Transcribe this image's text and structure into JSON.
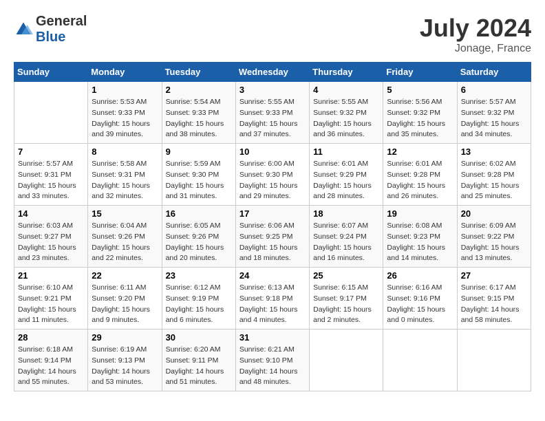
{
  "header": {
    "logo_text_general": "General",
    "logo_text_blue": "Blue",
    "month_year": "July 2024",
    "location": "Jonage, France"
  },
  "calendar": {
    "days_of_week": [
      "Sunday",
      "Monday",
      "Tuesday",
      "Wednesday",
      "Thursday",
      "Friday",
      "Saturday"
    ],
    "weeks": [
      [
        {
          "day": "",
          "sunrise": "",
          "sunset": "",
          "daylight": ""
        },
        {
          "day": "1",
          "sunrise": "Sunrise: 5:53 AM",
          "sunset": "Sunset: 9:33 PM",
          "daylight": "Daylight: 15 hours and 39 minutes."
        },
        {
          "day": "2",
          "sunrise": "Sunrise: 5:54 AM",
          "sunset": "Sunset: 9:33 PM",
          "daylight": "Daylight: 15 hours and 38 minutes."
        },
        {
          "day": "3",
          "sunrise": "Sunrise: 5:55 AM",
          "sunset": "Sunset: 9:33 PM",
          "daylight": "Daylight: 15 hours and 37 minutes."
        },
        {
          "day": "4",
          "sunrise": "Sunrise: 5:55 AM",
          "sunset": "Sunset: 9:32 PM",
          "daylight": "Daylight: 15 hours and 36 minutes."
        },
        {
          "day": "5",
          "sunrise": "Sunrise: 5:56 AM",
          "sunset": "Sunset: 9:32 PM",
          "daylight": "Daylight: 15 hours and 35 minutes."
        },
        {
          "day": "6",
          "sunrise": "Sunrise: 5:57 AM",
          "sunset": "Sunset: 9:32 PM",
          "daylight": "Daylight: 15 hours and 34 minutes."
        }
      ],
      [
        {
          "day": "7",
          "sunrise": "Sunrise: 5:57 AM",
          "sunset": "Sunset: 9:31 PM",
          "daylight": "Daylight: 15 hours and 33 minutes."
        },
        {
          "day": "8",
          "sunrise": "Sunrise: 5:58 AM",
          "sunset": "Sunset: 9:31 PM",
          "daylight": "Daylight: 15 hours and 32 minutes."
        },
        {
          "day": "9",
          "sunrise": "Sunrise: 5:59 AM",
          "sunset": "Sunset: 9:30 PM",
          "daylight": "Daylight: 15 hours and 31 minutes."
        },
        {
          "day": "10",
          "sunrise": "Sunrise: 6:00 AM",
          "sunset": "Sunset: 9:30 PM",
          "daylight": "Daylight: 15 hours and 29 minutes."
        },
        {
          "day": "11",
          "sunrise": "Sunrise: 6:01 AM",
          "sunset": "Sunset: 9:29 PM",
          "daylight": "Daylight: 15 hours and 28 minutes."
        },
        {
          "day": "12",
          "sunrise": "Sunrise: 6:01 AM",
          "sunset": "Sunset: 9:28 PM",
          "daylight": "Daylight: 15 hours and 26 minutes."
        },
        {
          "day": "13",
          "sunrise": "Sunrise: 6:02 AM",
          "sunset": "Sunset: 9:28 PM",
          "daylight": "Daylight: 15 hours and 25 minutes."
        }
      ],
      [
        {
          "day": "14",
          "sunrise": "Sunrise: 6:03 AM",
          "sunset": "Sunset: 9:27 PM",
          "daylight": "Daylight: 15 hours and 23 minutes."
        },
        {
          "day": "15",
          "sunrise": "Sunrise: 6:04 AM",
          "sunset": "Sunset: 9:26 PM",
          "daylight": "Daylight: 15 hours and 22 minutes."
        },
        {
          "day": "16",
          "sunrise": "Sunrise: 6:05 AM",
          "sunset": "Sunset: 9:26 PM",
          "daylight": "Daylight: 15 hours and 20 minutes."
        },
        {
          "day": "17",
          "sunrise": "Sunrise: 6:06 AM",
          "sunset": "Sunset: 9:25 PM",
          "daylight": "Daylight: 15 hours and 18 minutes."
        },
        {
          "day": "18",
          "sunrise": "Sunrise: 6:07 AM",
          "sunset": "Sunset: 9:24 PM",
          "daylight": "Daylight: 15 hours and 16 minutes."
        },
        {
          "day": "19",
          "sunrise": "Sunrise: 6:08 AM",
          "sunset": "Sunset: 9:23 PM",
          "daylight": "Daylight: 15 hours and 14 minutes."
        },
        {
          "day": "20",
          "sunrise": "Sunrise: 6:09 AM",
          "sunset": "Sunset: 9:22 PM",
          "daylight": "Daylight: 15 hours and 13 minutes."
        }
      ],
      [
        {
          "day": "21",
          "sunrise": "Sunrise: 6:10 AM",
          "sunset": "Sunset: 9:21 PM",
          "daylight": "Daylight: 15 hours and 11 minutes."
        },
        {
          "day": "22",
          "sunrise": "Sunrise: 6:11 AM",
          "sunset": "Sunset: 9:20 PM",
          "daylight": "Daylight: 15 hours and 9 minutes."
        },
        {
          "day": "23",
          "sunrise": "Sunrise: 6:12 AM",
          "sunset": "Sunset: 9:19 PM",
          "daylight": "Daylight: 15 hours and 6 minutes."
        },
        {
          "day": "24",
          "sunrise": "Sunrise: 6:13 AM",
          "sunset": "Sunset: 9:18 PM",
          "daylight": "Daylight: 15 hours and 4 minutes."
        },
        {
          "day": "25",
          "sunrise": "Sunrise: 6:15 AM",
          "sunset": "Sunset: 9:17 PM",
          "daylight": "Daylight: 15 hours and 2 minutes."
        },
        {
          "day": "26",
          "sunrise": "Sunrise: 6:16 AM",
          "sunset": "Sunset: 9:16 PM",
          "daylight": "Daylight: 15 hours and 0 minutes."
        },
        {
          "day": "27",
          "sunrise": "Sunrise: 6:17 AM",
          "sunset": "Sunset: 9:15 PM",
          "daylight": "Daylight: 14 hours and 58 minutes."
        }
      ],
      [
        {
          "day": "28",
          "sunrise": "Sunrise: 6:18 AM",
          "sunset": "Sunset: 9:14 PM",
          "daylight": "Daylight: 14 hours and 55 minutes."
        },
        {
          "day": "29",
          "sunrise": "Sunrise: 6:19 AM",
          "sunset": "Sunset: 9:13 PM",
          "daylight": "Daylight: 14 hours and 53 minutes."
        },
        {
          "day": "30",
          "sunrise": "Sunrise: 6:20 AM",
          "sunset": "Sunset: 9:11 PM",
          "daylight": "Daylight: 14 hours and 51 minutes."
        },
        {
          "day": "31",
          "sunrise": "Sunrise: 6:21 AM",
          "sunset": "Sunset: 9:10 PM",
          "daylight": "Daylight: 14 hours and 48 minutes."
        },
        {
          "day": "",
          "sunrise": "",
          "sunset": "",
          "daylight": ""
        },
        {
          "day": "",
          "sunrise": "",
          "sunset": "",
          "daylight": ""
        },
        {
          "day": "",
          "sunrise": "",
          "sunset": "",
          "daylight": ""
        }
      ]
    ]
  }
}
